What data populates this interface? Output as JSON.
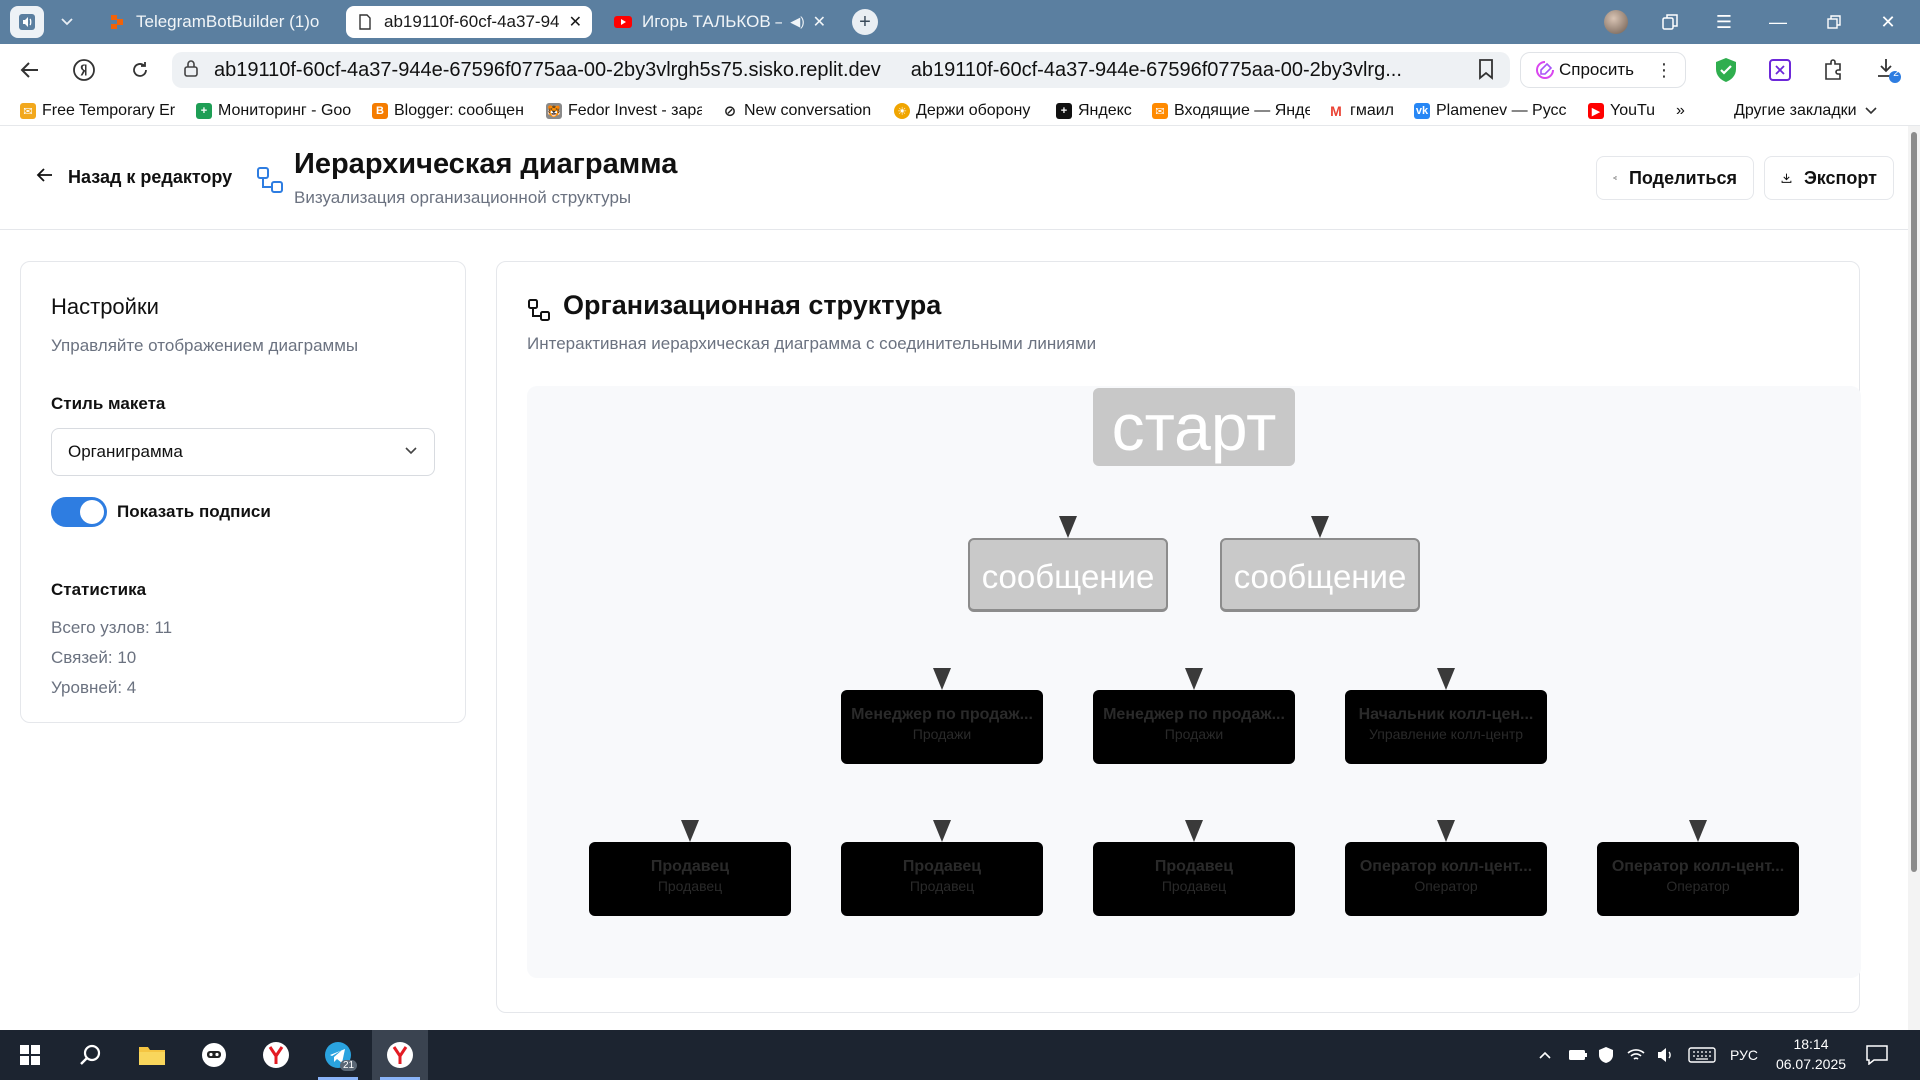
{
  "browser": {
    "tabs": [
      {
        "title": "TelegramBotBuilder (1)o",
        "favicon": "replit-icon",
        "active": false
      },
      {
        "title": "ab19110f-60cf-4a37-94",
        "favicon": "page-icon",
        "active": true
      },
      {
        "title": "Игорь ТАЛЬКОВ — /",
        "favicon": "youtube-icon",
        "active": false
      }
    ],
    "url_host": "ab19110f-60cf-4a37-944e-67596f0775aa-00-2by3vlrgh5s75.sisko.replit.dev",
    "url_title": "ab19110f-60cf-4a37-944e-67596f0775aa-00-2by3vlrg...",
    "ask_label": "Спросить",
    "downloads_count": "2",
    "bookmarks": [
      {
        "label": "Free Temporary Er",
        "color": "#f2a81d"
      },
      {
        "label": "Мониторинг - Goo",
        "color": "#1e9e55"
      },
      {
        "label": "Blogger: сообщен",
        "color": "#f57c00"
      },
      {
        "label": "Fedor Invest - зара",
        "color": "#8a8a8a"
      },
      {
        "label": "New conversation",
        "color": "#222222"
      },
      {
        "label": "Держи оборону",
        "color": "#f0a500"
      },
      {
        "label": "Яндекс",
        "color": "#111111"
      },
      {
        "label": "Входящие — Янде",
        "color": "#ff8a00"
      },
      {
        "label": "гмаил",
        "color": "#ea4335"
      },
      {
        "label": "Plamenev — Русс",
        "color": "#2787f5"
      },
      {
        "label": "YouTu",
        "color": "#ff0000"
      }
    ],
    "more_bookmarks": "»",
    "other_bookmarks": "Другие закладки"
  },
  "header": {
    "back_label": "Назад к редактору",
    "title": "Иерархическая диаграмма",
    "subtitle": "Визуализация организационной структуры",
    "share_label": "Поделиться",
    "export_label": "Экспорт"
  },
  "settings": {
    "title": "Настройки",
    "description": "Управляйте отображением диаграммы",
    "layout_label": "Стиль макета",
    "layout_value": "Органиграмма",
    "show_labels_label": "Показать подписи",
    "show_labels_on": true,
    "stats_title": "Статистика",
    "stats": [
      "Всего узлов: 11",
      "Связей: 10",
      "Уровней: 4"
    ]
  },
  "diagram": {
    "title": "Организационная структура",
    "description": "Интерактивная иерархическая диаграмма с соединительными линиями",
    "levels": [
      [
        {
          "title": "старт",
          "sub": "",
          "kind": "start"
        }
      ],
      [
        {
          "title": "сообщение",
          "sub": "",
          "kind": "msg"
        },
        {
          "title": "сообщение",
          "sub": "",
          "kind": "msg"
        }
      ],
      [
        {
          "title": "Менеджер по продаж...",
          "sub": "Продажи",
          "kind": "dark"
        },
        {
          "title": "Менеджер по продаж...",
          "sub": "Продажи",
          "kind": "dark"
        },
        {
          "title": "Начальник колл-цен...",
          "sub": "Управление колл-центр",
          "kind": "dark"
        }
      ],
      [
        {
          "title": "Продавец",
          "sub": "Продавец",
          "kind": "dark"
        },
        {
          "title": "Продавец",
          "sub": "Продавец",
          "kind": "dark"
        },
        {
          "title": "Продавец",
          "sub": "Продавец",
          "kind": "dark"
        },
        {
          "title": "Оператор колл-цент...",
          "sub": "Оператор",
          "kind": "dark"
        },
        {
          "title": "Оператор колл-цент...",
          "sub": "Оператор",
          "kind": "dark"
        }
      ]
    ]
  },
  "taskbar": {
    "apps": [
      "start-icon",
      "search-icon",
      "file-explorer-icon",
      "app-icon",
      "yandex-browser-icon",
      "telegram-icon",
      "yandex-browser-active-icon"
    ],
    "telegram_badge": "21",
    "language": "РУС",
    "time": "18:14",
    "date": "06.07.2025"
  }
}
